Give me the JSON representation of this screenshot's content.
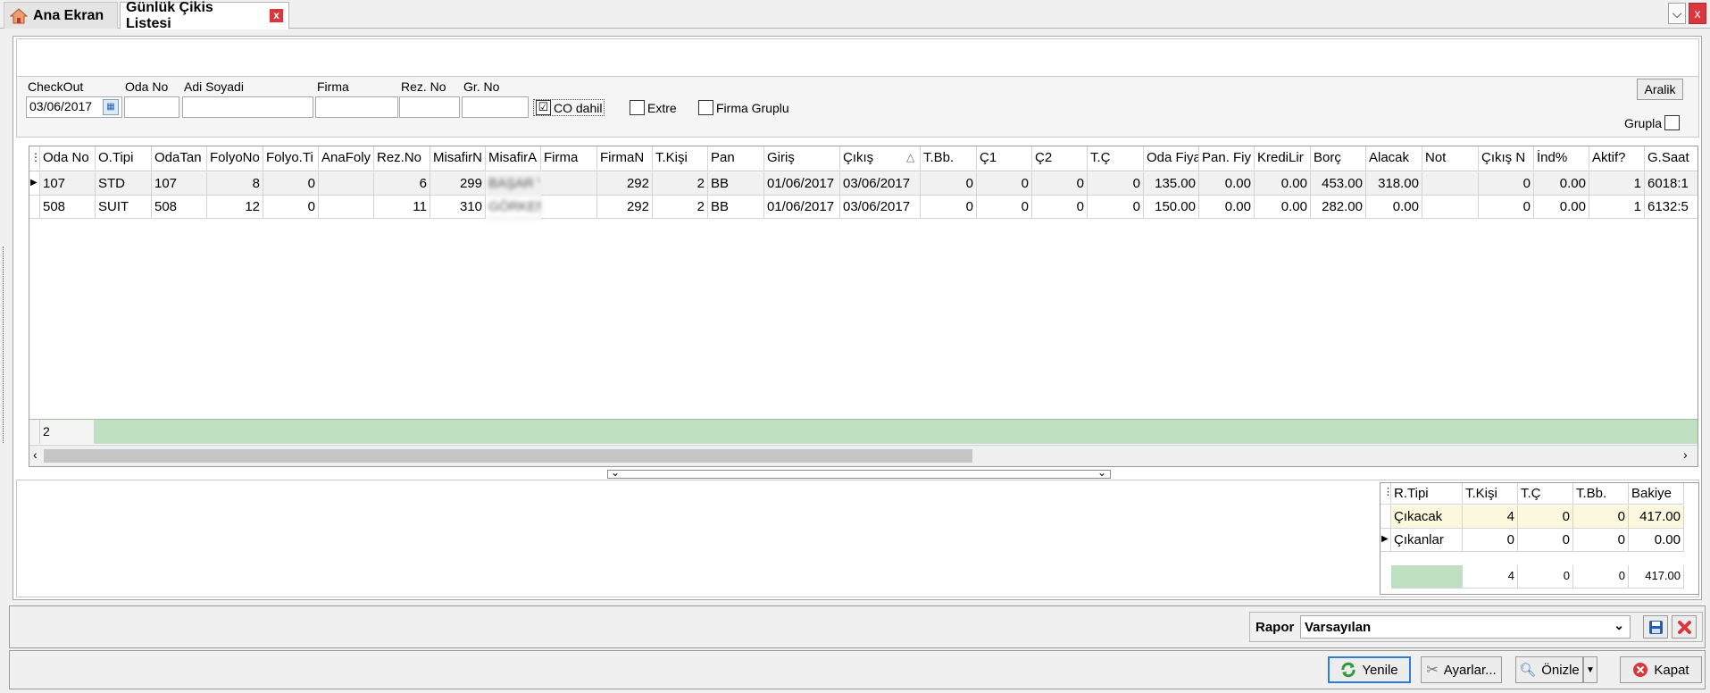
{
  "tabs": {
    "home": "Ana Ekran",
    "active": "Günlük Çikis Listesi",
    "close": "x"
  },
  "window": {
    "minimize": "⌵",
    "close": "x"
  },
  "filters": {
    "checkout_label": "CheckOut",
    "checkout_value": "03/06/2017",
    "odano_label": "Oda No",
    "adisoyadi_label": "Adi Soyadi",
    "firma_label": "Firma",
    "rezno_label": "Rez. No",
    "grno_label": "Gr. No",
    "co_dahil_label": "CO dahil",
    "co_dahil_checked": "☑",
    "extre_label": "Extre",
    "firma_gruplu_label": "Firma Gruplu",
    "aralik_label": "Aralik",
    "grupla_label": "Grupla"
  },
  "grid": {
    "columns": [
      "Oda No",
      "O.Tipi",
      "OdaTan",
      "FolyoNo",
      "Folyo.Ti",
      "AnaFoly",
      "Rez.No",
      "MisafirN",
      "MisafirA",
      "Firma",
      "FirmaN",
      "T.Kişi",
      "Pan",
      "Giriş",
      "Çıkış",
      "T.Bb.",
      "Ç1",
      "Ç2",
      "T.Ç",
      "Oda Fiya",
      "Pan. Fiy",
      "KrediLir",
      "Borç",
      "Alacak",
      "Not",
      "Çıkış N",
      "İnd%",
      "Aktif?",
      "G.Saat"
    ],
    "sort_indicator": "△",
    "rows": [
      [
        "107",
        "STD",
        "107",
        "8",
        "0",
        "",
        "6",
        "299",
        "BAŞAR YALSIN",
        "",
        "292",
        "2",
        "BB",
        "01/06/2017",
        "03/06/2017",
        "0",
        "0",
        "0",
        "0",
        "135.00",
        "0.00",
        "0.00",
        "453.00",
        "318.00",
        "",
        "0",
        "0.00",
        "1",
        "6018:1"
      ],
      [
        "508",
        "SUIT",
        "508",
        "12",
        "0",
        "",
        "11",
        "310",
        "GÖRKEM YALSIN",
        "",
        "292",
        "2",
        "BB",
        "01/06/2017",
        "03/06/2017",
        "0",
        "0",
        "0",
        "0",
        "150.00",
        "0.00",
        "0.00",
        "282.00",
        "0.00",
        "",
        "0",
        "0.00",
        "1",
        "6132:5"
      ]
    ],
    "footer_count": "2"
  },
  "summary": {
    "columns": [
      "R.Tipi",
      "T.Kişi",
      "T.Ç",
      "T.Bb.",
      "Bakiye"
    ],
    "rows": [
      [
        "Çıkacak",
        "4",
        "0",
        "0",
        "417.00"
      ],
      [
        "Çıkanlar",
        "0",
        "0",
        "0",
        "0.00"
      ]
    ],
    "totals": [
      "",
      "4",
      "0",
      "0",
      "417.00"
    ]
  },
  "report": {
    "label": "Rapor",
    "value": "Varsayılan"
  },
  "actions": {
    "yenile": "Yenile",
    "ayarlar": "Ayarlar...",
    "onizle": "Önizle",
    "kapat": "Kapat"
  },
  "colors": {
    "footer_green": "#bfe0c0",
    "tab_close": "#d9363e",
    "summary_yellow": "#fbf8dd",
    "focus_blue": "#2c7fd6"
  }
}
